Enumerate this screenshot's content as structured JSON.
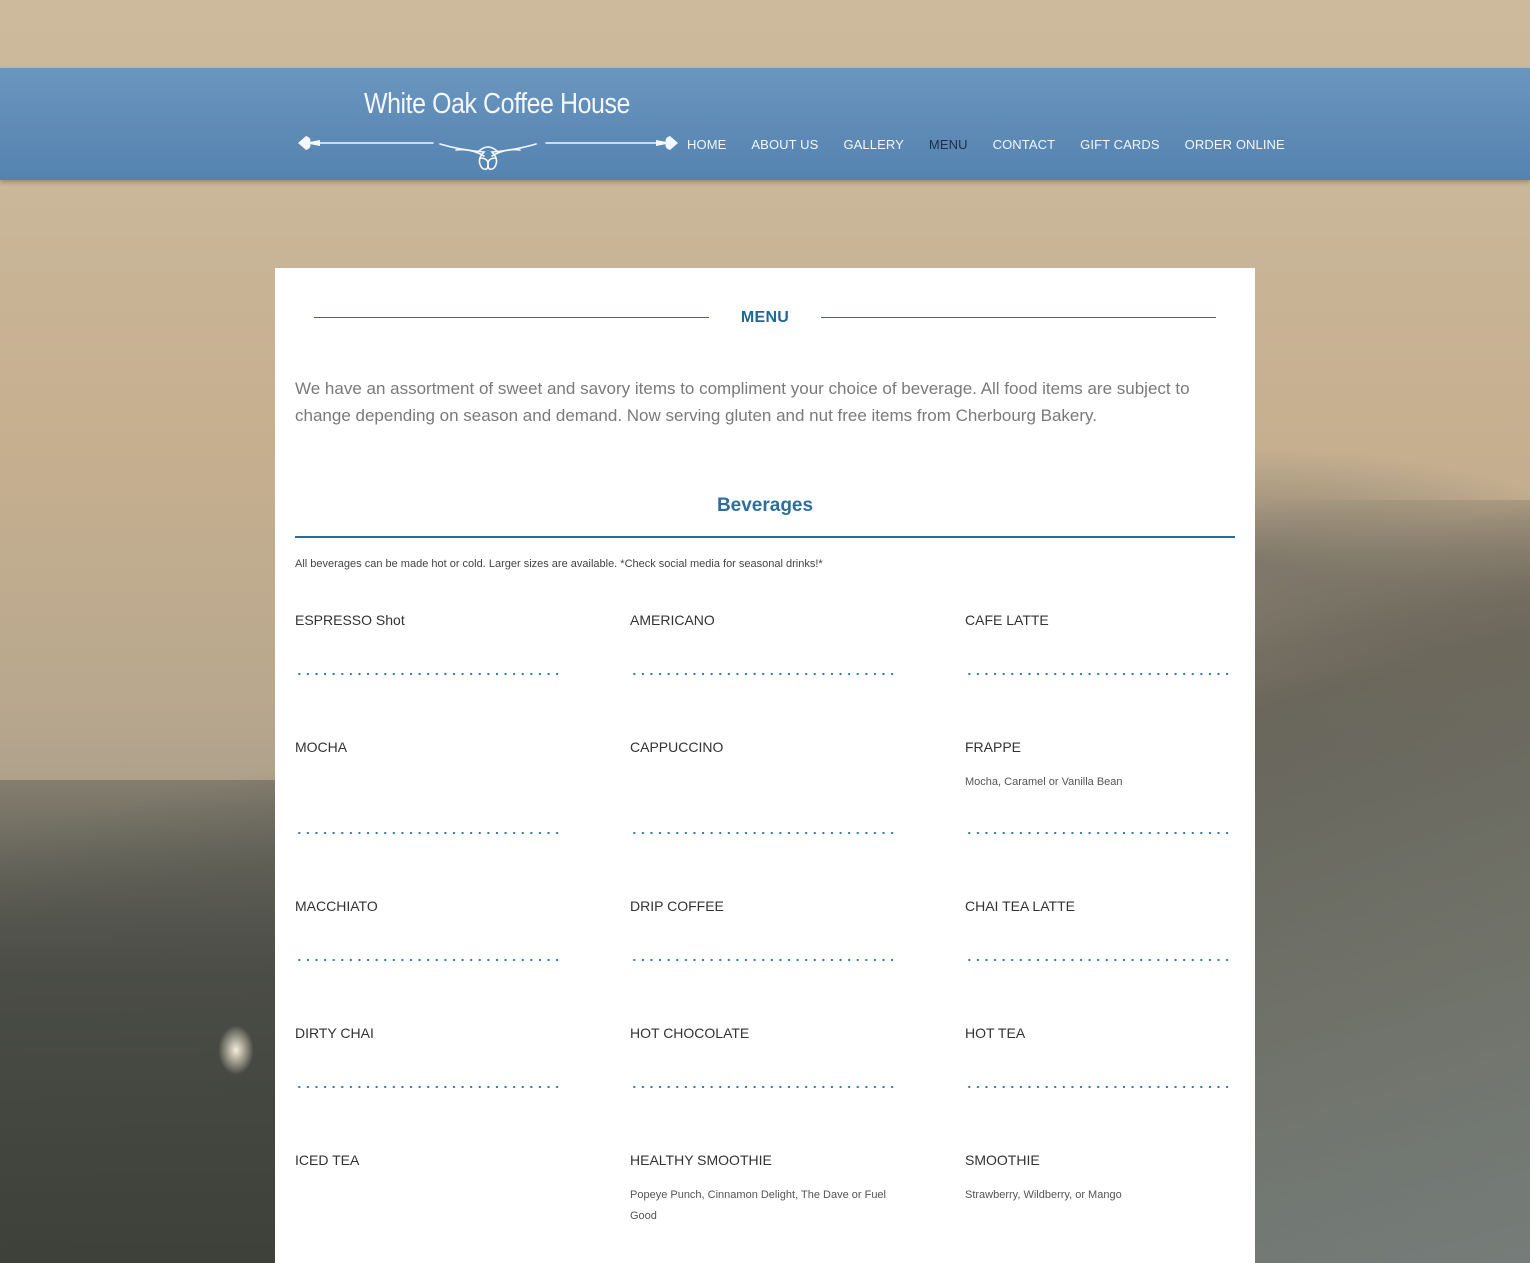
{
  "site": {
    "title": "White Oak Coffee House"
  },
  "nav": {
    "items": [
      {
        "label": "HOME",
        "active": false
      },
      {
        "label": "ABOUT US",
        "active": false
      },
      {
        "label": "GALLERY",
        "active": false
      },
      {
        "label": "MENU",
        "active": true
      },
      {
        "label": "CONTACT",
        "active": false
      },
      {
        "label": "GIFT CARDS",
        "active": false
      },
      {
        "label": "ORDER ONLINE",
        "active": false
      }
    ]
  },
  "page": {
    "title": "MENU",
    "intro": "We have an assortment of sweet and savory items to compliment your choice of beverage. All food items are subject to change depending on season and demand. Now serving gluten and nut free items from Cherbourg Bakery."
  },
  "beverages": {
    "title": "Beverages",
    "note": "All beverages can be made hot or cold. Larger sizes are available. *Check social media for seasonal drinks!*",
    "items": [
      {
        "name": "ESPRESSO Shot",
        "desc": ""
      },
      {
        "name": "AMERICANO",
        "desc": ""
      },
      {
        "name": "CAFE LATTE",
        "desc": ""
      },
      {
        "name": "MOCHA",
        "desc": ""
      },
      {
        "name": "CAPPUCCINO",
        "desc": ""
      },
      {
        "name": "FRAPPE",
        "desc": "Mocha, Caramel or Vanilla Bean"
      },
      {
        "name": "MACCHIATO",
        "desc": ""
      },
      {
        "name": "DRIP COFFEE",
        "desc": ""
      },
      {
        "name": "CHAI TEA LATTE",
        "desc": ""
      },
      {
        "name": "DIRTY CHAI",
        "desc": ""
      },
      {
        "name": "HOT CHOCOLATE",
        "desc": ""
      },
      {
        "name": "HOT TEA",
        "desc": ""
      },
      {
        "name": "ICED TEA",
        "desc": ""
      },
      {
        "name": "HEALTHY SMOOTHIE",
        "desc": "Popeye Punch, Cinnamon Delight, The Dave or Fuel Good"
      },
      {
        "name": "SMOOTHIE",
        "desc": "Strawberry, Wildberry, or Mango"
      }
    ]
  }
}
